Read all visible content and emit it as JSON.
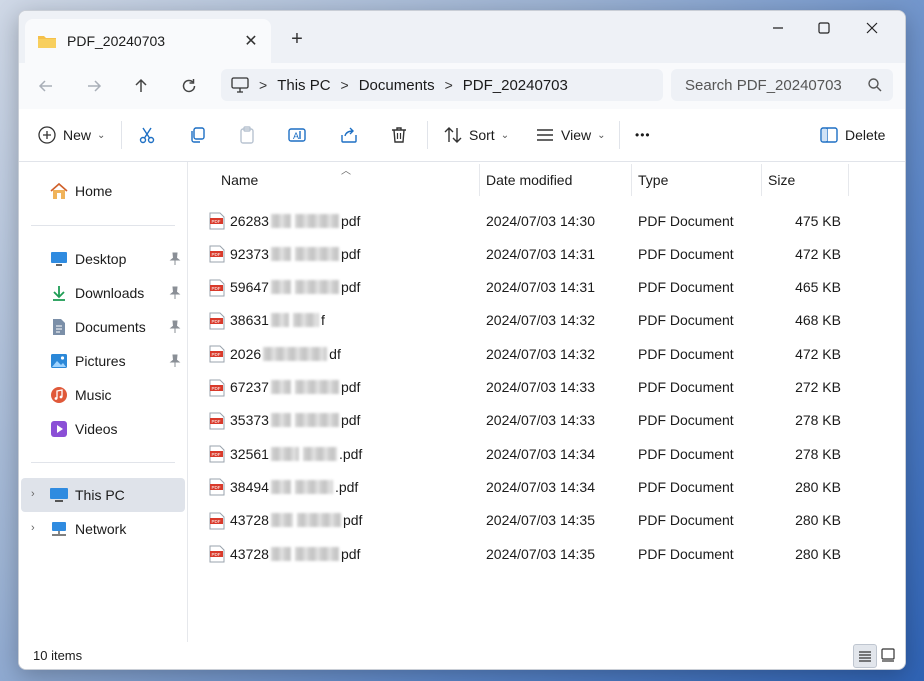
{
  "window": {
    "tab_title": "PDF_20240703",
    "new_tab_symbol": "+"
  },
  "address": {
    "crumbs": [
      "This PC",
      "Documents",
      "PDF_20240703"
    ],
    "search_placeholder": "Search PDF_20240703"
  },
  "toolbar": {
    "new_label": "New",
    "sort_label": "Sort",
    "view_label": "View",
    "more_label": "•••",
    "delete_label": "Delete"
  },
  "sidebar": {
    "home": "Home",
    "quick": [
      {
        "label": "Desktop",
        "icon": "desktop-icon",
        "pinned": true
      },
      {
        "label": "Downloads",
        "icon": "download-icon",
        "pinned": true
      },
      {
        "label": "Documents",
        "icon": "documents-icon",
        "pinned": true
      },
      {
        "label": "Pictures",
        "icon": "pictures-icon",
        "pinned": true
      },
      {
        "label": "Music",
        "icon": "music-icon",
        "pinned": false
      },
      {
        "label": "Videos",
        "icon": "videos-icon",
        "pinned": false
      }
    ],
    "this_pc": "This PC",
    "network": "Network"
  },
  "columns": {
    "name": "Name",
    "date": "Date modified",
    "type": "Type",
    "size": "Size"
  },
  "files": [
    {
      "prefix": "26283",
      "suffix": "pdf",
      "date": "2024/07/03 14:30",
      "type": "PDF Document",
      "size": "475 KB"
    },
    {
      "prefix": "92373",
      "suffix": "pdf",
      "date": "2024/07/03 14:31",
      "type": "PDF Document",
      "size": "472 KB"
    },
    {
      "prefix": "59647",
      "suffix": "pdf",
      "date": "2024/07/03 14:31",
      "type": "PDF Document",
      "size": "465 KB"
    },
    {
      "prefix": "38631",
      "suffix": "f",
      "date": "2024/07/03 14:32",
      "type": "PDF Document",
      "size": "468 KB"
    },
    {
      "prefix": "2026",
      "suffix": "df",
      "date": "2024/07/03 14:32",
      "type": "PDF Document",
      "size": "472 KB"
    },
    {
      "prefix": "67237",
      "suffix": "pdf",
      "date": "2024/07/03 14:33",
      "type": "PDF Document",
      "size": "272 KB"
    },
    {
      "prefix": "35373",
      "suffix": "pdf",
      "date": "2024/07/03 14:33",
      "type": "PDF Document",
      "size": "278 KB"
    },
    {
      "prefix": "32561",
      "suffix": ".pdf",
      "date": "2024/07/03 14:34",
      "type": "PDF Document",
      "size": "278 KB"
    },
    {
      "prefix": "38494",
      "suffix": ".pdf",
      "date": "2024/07/03 14:34",
      "type": "PDF Document",
      "size": "280 KB"
    },
    {
      "prefix": "43728",
      "suffix": "pdf",
      "date": "2024/07/03 14:35",
      "type": "PDF Document",
      "size": "280 KB"
    },
    {
      "prefix": "43728",
      "suffix": "pdf",
      "date": "2024/07/03 14:35",
      "type": "PDF Document",
      "size": "280 KB"
    }
  ],
  "status": {
    "count_text": "10 items"
  },
  "colors": {
    "accent": "#0067c0",
    "pdf_red": "#d93a2b",
    "folder_yellow": "#f5c04a"
  }
}
